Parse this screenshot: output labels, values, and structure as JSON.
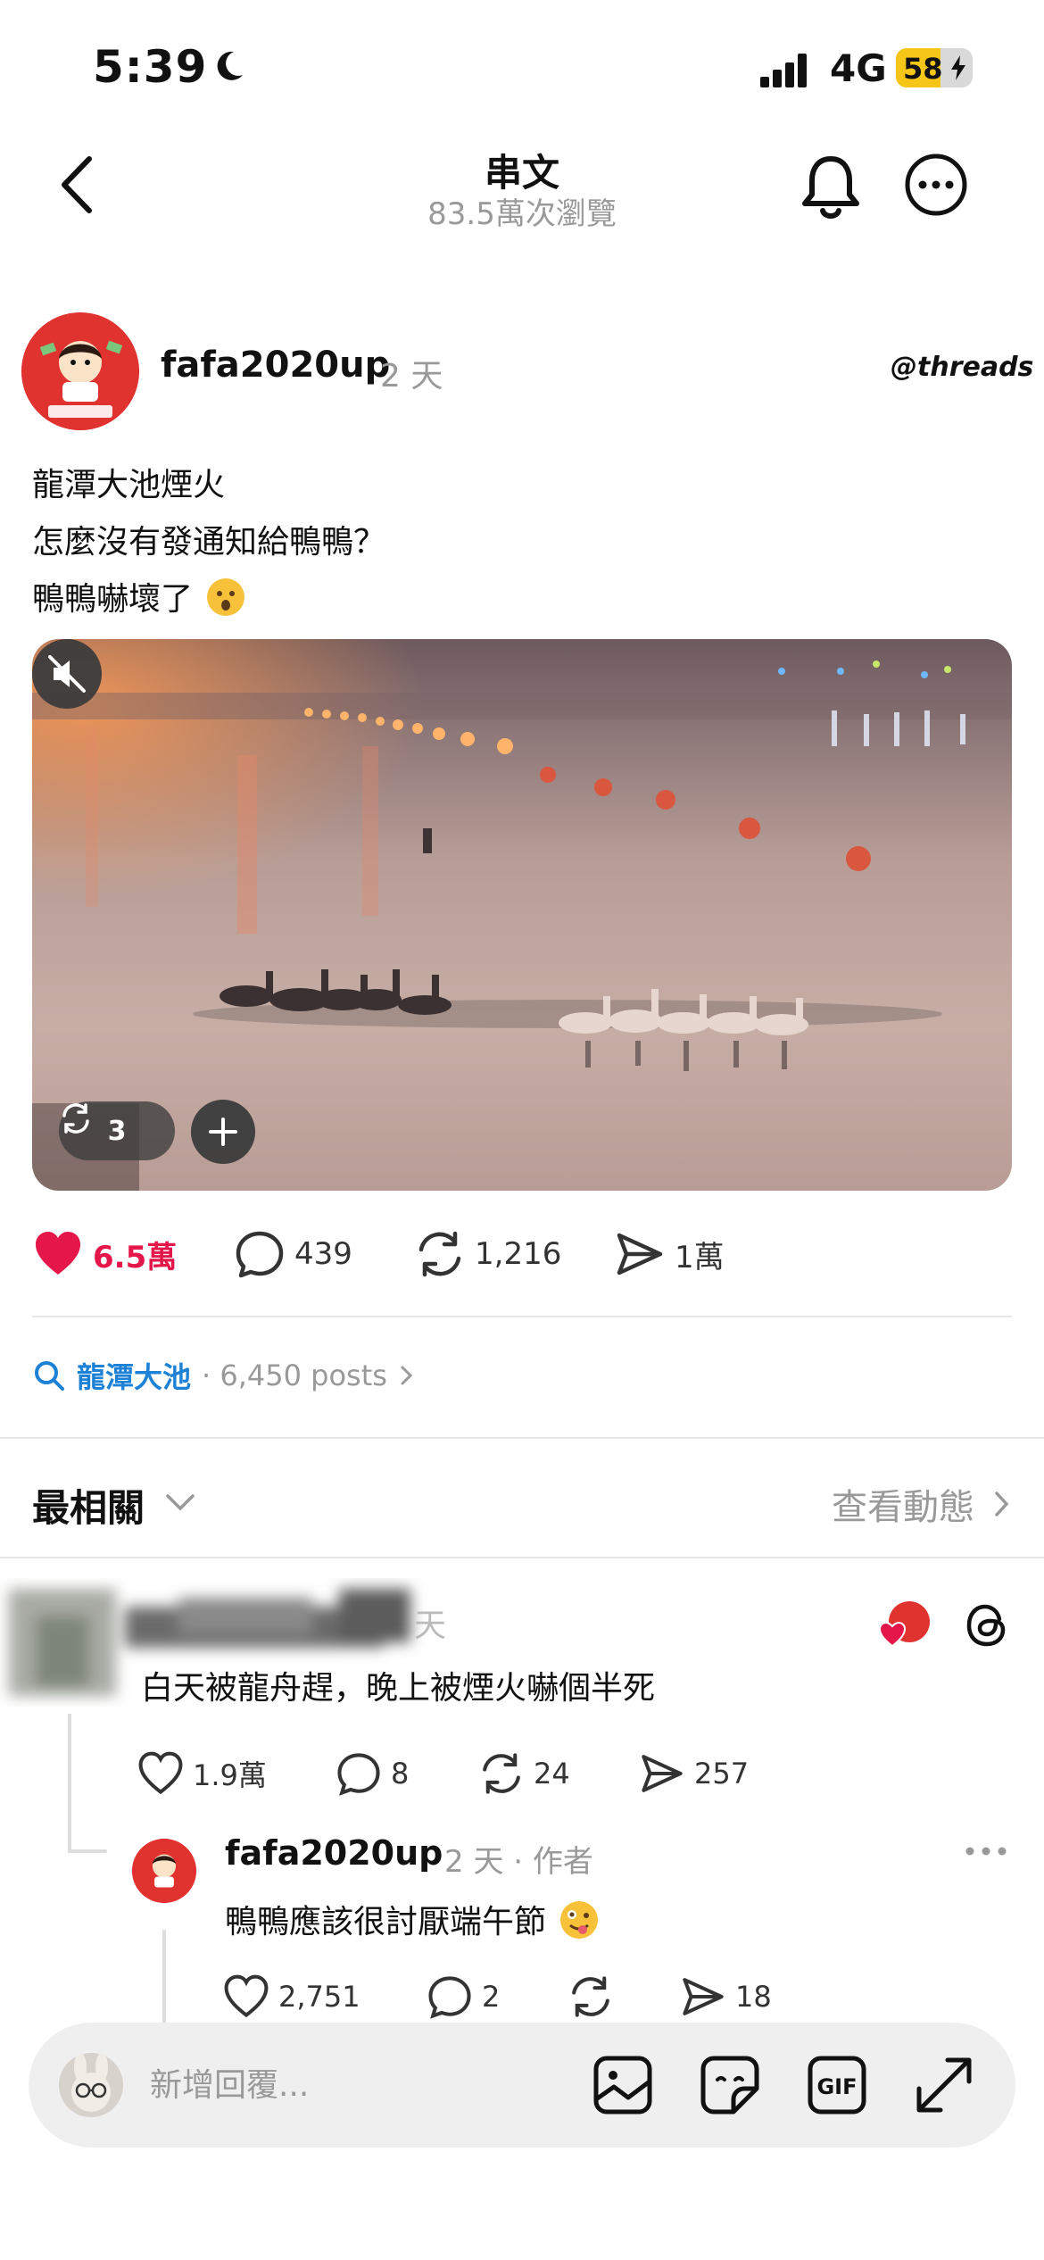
{
  "status_bar": {
    "time": "5:39",
    "network": "4G",
    "battery": "58",
    "battery_level": 0.58
  },
  "header": {
    "title": "串文",
    "views": "83.5萬次瀏覽"
  },
  "post": {
    "username": "fafa2020up",
    "age": "2 天",
    "badge": "threads",
    "lines": [
      "龍潭大池煙火",
      "怎麼沒有發通知給鴨鴨？",
      "鴨鴨嚇壞了"
    ],
    "media": {
      "repost_count": "3"
    },
    "actions": {
      "likes": "6.5萬",
      "comments": "439",
      "reposts": "1,216",
      "shares": "1萬"
    }
  },
  "topic": {
    "name": "龍潭大池",
    "count": "· 6,450 posts"
  },
  "comments_header": {
    "sort_label": "最相關",
    "activity_link": "查看動態"
  },
  "comments": [
    {
      "age": "天",
      "text": "白天被龍舟趕，晚上被煙火嚇個半死",
      "likes": "1.9萬",
      "replies": "8",
      "reposts": "24",
      "shares": "257"
    },
    {
      "username": "fafa2020up",
      "meta": "2 天 · 作者",
      "text": "鴨鴨應該很討厭端午節",
      "likes": "2,751",
      "replies": "2",
      "reposts": "",
      "shares": "18"
    }
  ],
  "reply_bar": {
    "placeholder": "新增回覆..."
  },
  "colors": {
    "like_red": "#e4164a",
    "topic_blue": "#1d82d6",
    "battery_yellow": "#f5c518",
    "avatar_red": "#e0322f"
  }
}
